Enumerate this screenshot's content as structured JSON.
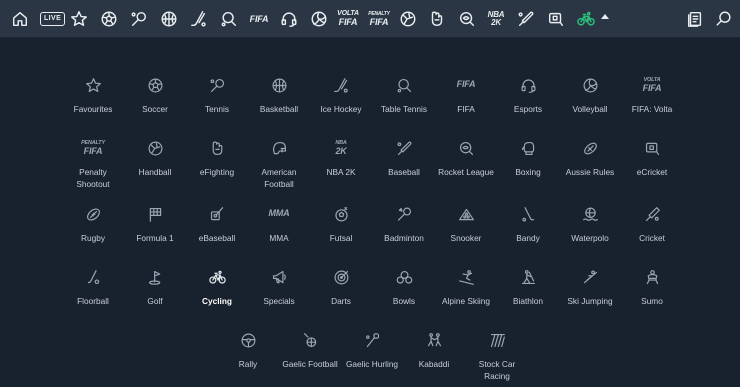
{
  "topbar": {
    "live_label": "LIVE",
    "fifa_label": "FIFA",
    "volta_label": "VOLTA",
    "penalty_label": "PENALTY",
    "nba_label": "NBA 2K"
  },
  "sports": [
    {
      "label": "Favourites",
      "icon": "star-icon"
    },
    {
      "label": "Soccer",
      "icon": "soccer-ball-icon"
    },
    {
      "label": "Tennis",
      "icon": "tennis-racket-icon"
    },
    {
      "label": "Basketball",
      "icon": "basketball-icon"
    },
    {
      "label": "Ice Hockey",
      "icon": "hockey-stick-icon"
    },
    {
      "label": "Table Tennis",
      "icon": "table-tennis-icon"
    },
    {
      "label": "FIFA",
      "icon": "fifa-logo-icon"
    },
    {
      "label": "Esports",
      "icon": "headset-icon"
    },
    {
      "label": "Volleyball",
      "icon": "volleyball-icon"
    },
    {
      "label": "FIFA: Volta",
      "icon": "fifa-volta-logo-icon"
    },
    {
      "label": "Penalty Shootout",
      "icon": "penalty-fifa-logo-icon"
    },
    {
      "label": "Handball",
      "icon": "handball-icon"
    },
    {
      "label": "eFighting",
      "icon": "fist-icon"
    },
    {
      "label": "American Football",
      "icon": "helmet-icon"
    },
    {
      "label": "NBA 2K",
      "icon": "nba2k-logo-icon"
    },
    {
      "label": "Baseball",
      "icon": "baseball-bat-icon"
    },
    {
      "label": "Rocket League",
      "icon": "rocket-league-icon"
    },
    {
      "label": "Boxing",
      "icon": "boxing-glove-icon"
    },
    {
      "label": "Aussie Rules",
      "icon": "aussie-rules-ball-icon"
    },
    {
      "label": "eCricket",
      "icon": "ecricket-icon"
    },
    {
      "label": "Rugby",
      "icon": "rugby-ball-icon"
    },
    {
      "label": "Formula 1",
      "icon": "checkered-flag-icon"
    },
    {
      "label": "eBaseball",
      "icon": "ebaseball-icon"
    },
    {
      "label": "MMA",
      "icon": "mma-logo-icon"
    },
    {
      "label": "Futsal",
      "icon": "futsal-icon"
    },
    {
      "label": "Badminton",
      "icon": "badminton-icon"
    },
    {
      "label": "Snooker",
      "icon": "snooker-icon"
    },
    {
      "label": "Bandy",
      "icon": "bandy-stick-icon"
    },
    {
      "label": "Waterpolo",
      "icon": "waterpolo-icon"
    },
    {
      "label": "Cricket",
      "icon": "cricket-bat-icon"
    },
    {
      "label": "Floorball",
      "icon": "floorball-stick-icon"
    },
    {
      "label": "Golf",
      "icon": "golf-flag-icon"
    },
    {
      "label": "Cycling",
      "icon": "bicycle-icon",
      "active": true
    },
    {
      "label": "Specials",
      "icon": "megaphone-icon"
    },
    {
      "label": "Darts",
      "icon": "dartboard-icon"
    },
    {
      "label": "Bowls",
      "icon": "bowls-icon"
    },
    {
      "label": "Alpine Skiing",
      "icon": "skier-icon"
    },
    {
      "label": "Biathlon",
      "icon": "biathlon-icon"
    },
    {
      "label": "Ski Jumping",
      "icon": "ski-jumper-icon"
    },
    {
      "label": "Sumo",
      "icon": "sumo-wrestler-icon"
    },
    {
      "label": "Rally",
      "icon": "steering-wheel-icon"
    },
    {
      "label": "Gaelic Football",
      "icon": "gaelic-football-icon"
    },
    {
      "label": "Gaelic Hurling",
      "icon": "hurling-stick-icon"
    },
    {
      "label": "Kabaddi",
      "icon": "kabaddi-icon"
    },
    {
      "label": "Stock Car Racing",
      "icon": "stock-car-icon"
    }
  ],
  "colors": {
    "active": "#2bbf7a",
    "background": "#18222e",
    "topbar": "#2a3643"
  }
}
